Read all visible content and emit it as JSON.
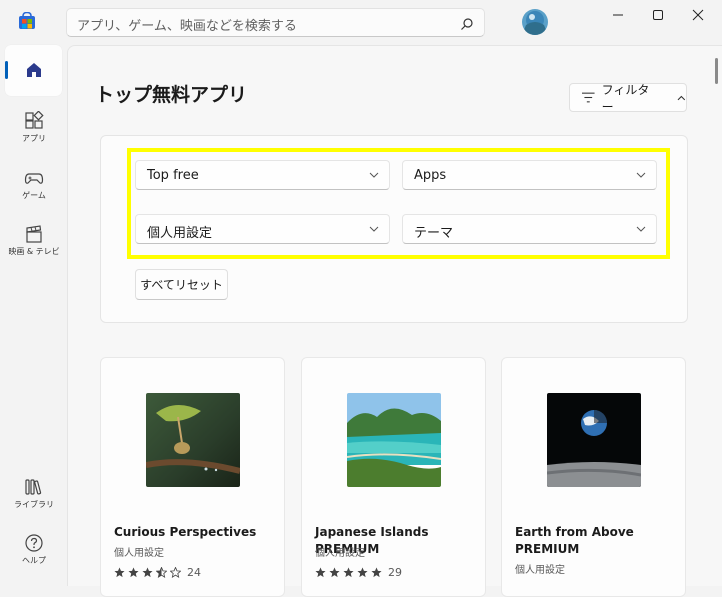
{
  "search": {
    "placeholder": "アプリ、ゲーム、映画などを検索する"
  },
  "sidebar": {
    "items": [
      {
        "label": ""
      },
      {
        "label": "アプリ"
      },
      {
        "label": "ゲーム"
      },
      {
        "label": "映画 & テレビ"
      },
      {
        "label": "ライブラリ"
      },
      {
        "label": "ヘルプ"
      }
    ]
  },
  "page": {
    "title": "トップ無料アプリ"
  },
  "filter": {
    "button_label": "フィルター",
    "dropdowns": [
      {
        "value": "Top free"
      },
      {
        "value": "Apps"
      },
      {
        "value": "個人用設定"
      },
      {
        "value": "テーマ"
      }
    ],
    "reset_label": "すべてリセット"
  },
  "cards": [
    {
      "title": "Curious Perspectives",
      "category": "個人用設定",
      "rating": 3.5,
      "rating_count": "24"
    },
    {
      "title": "Japanese Islands PREMIUM",
      "category": "個人用設定",
      "rating": 5,
      "rating_count": "29"
    },
    {
      "title": "Earth from Above PREMIUM",
      "category": "個人用設定"
    }
  ],
  "colors": {
    "accent": "#005fb8",
    "highlight": "#ffff00"
  }
}
